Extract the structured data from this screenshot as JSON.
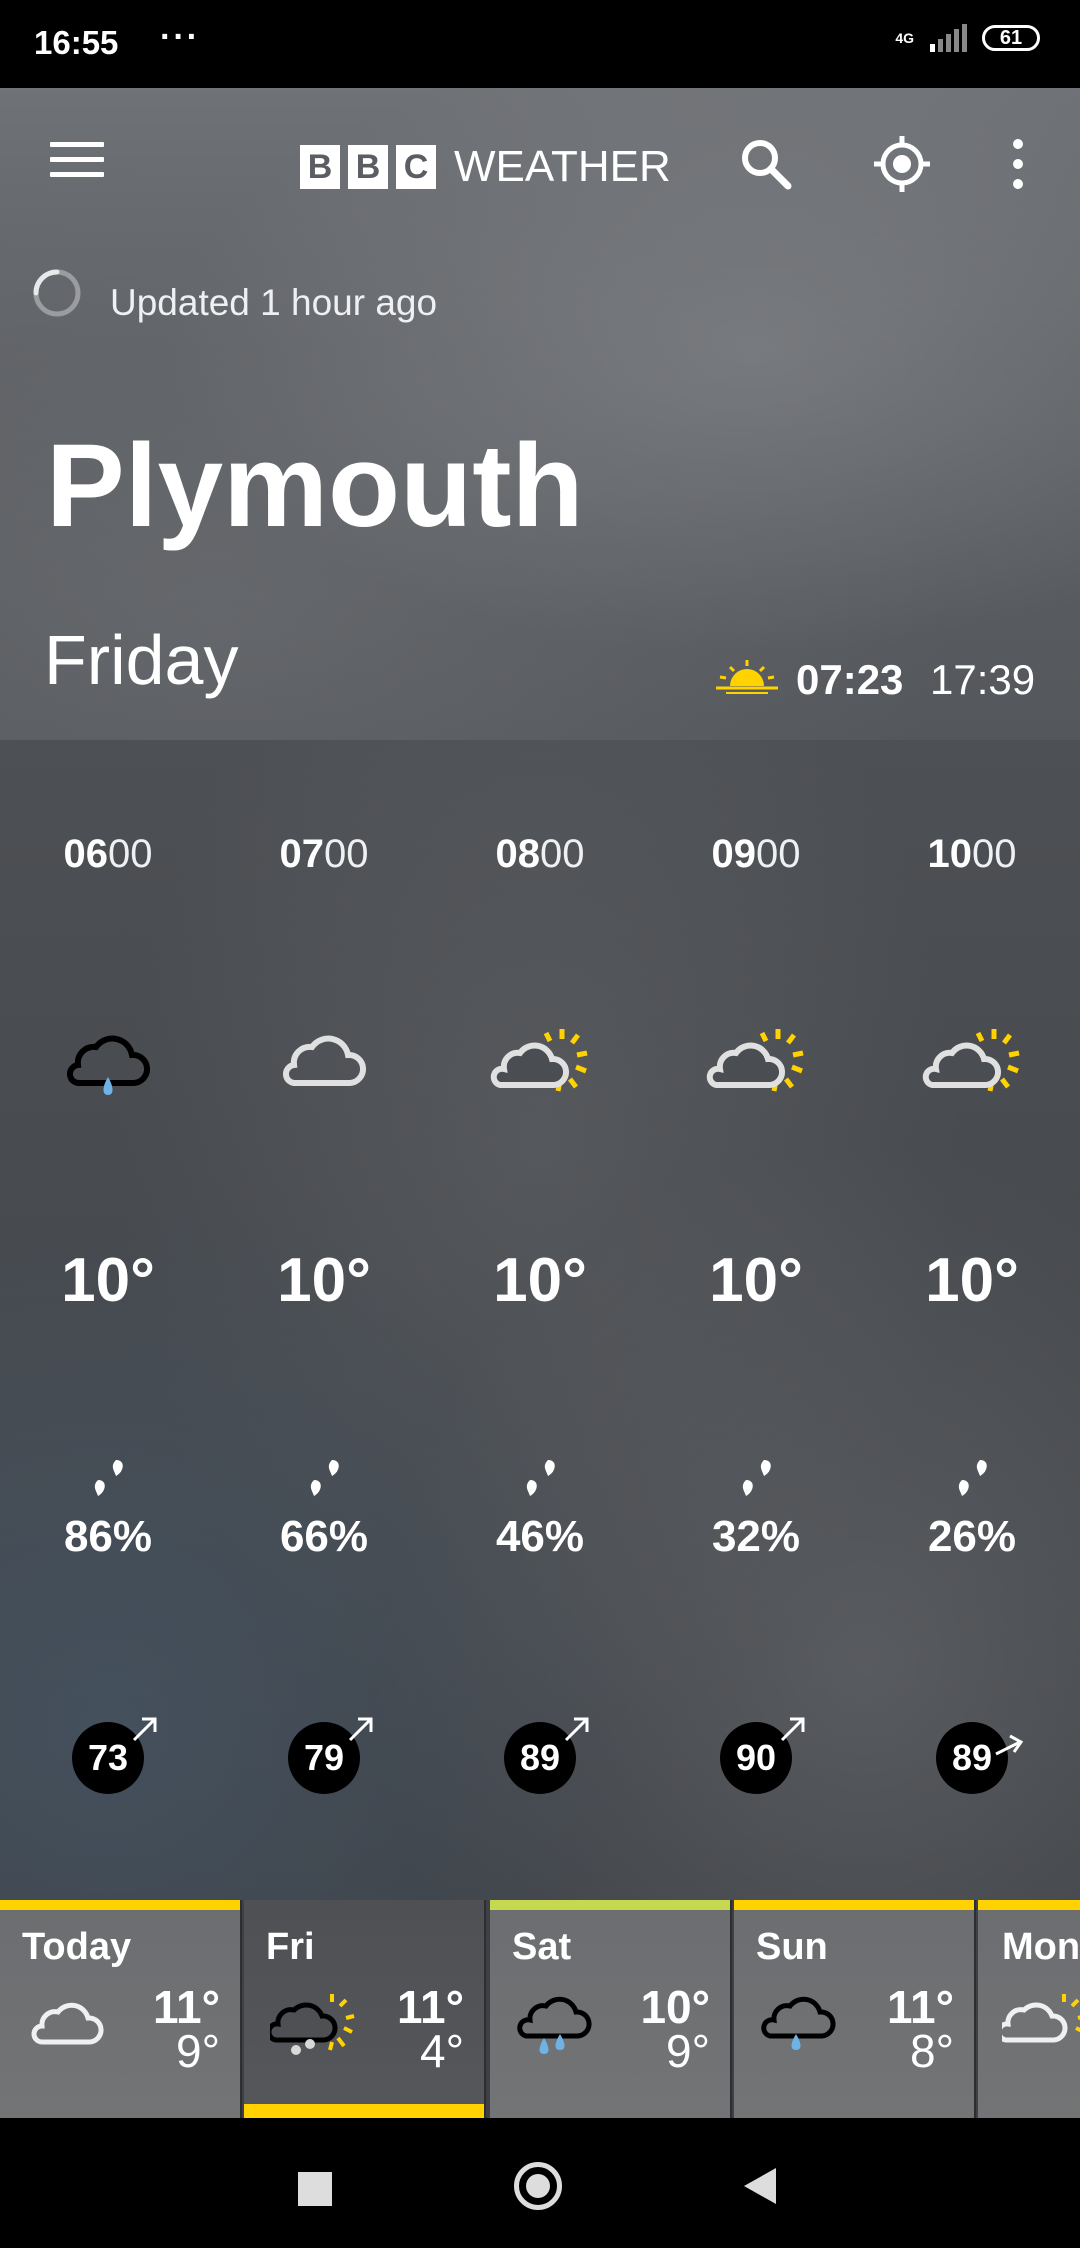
{
  "status_bar": {
    "time": "16:55",
    "dots": "···",
    "network": "4G",
    "battery": "61"
  },
  "header": {
    "brand_letters": [
      "B",
      "B",
      "C"
    ],
    "brand_word": "WEATHER",
    "updated": "Updated 1 hour ago",
    "city": "Plymouth",
    "day": "Friday",
    "sunrise": "07:23",
    "sunset": "17:39"
  },
  "hourly": [
    {
      "time_bold": "06",
      "time_rest": "00",
      "icon": "cloud-light-rain-icon",
      "temp": "10°",
      "rain": "86%",
      "wind": "73"
    },
    {
      "time_bold": "07",
      "time_rest": "00",
      "icon": "cloud-icon",
      "temp": "10°",
      "rain": "66%",
      "wind": "79"
    },
    {
      "time_bold": "08",
      "time_rest": "00",
      "icon": "sun-cloud-icon",
      "temp": "10°",
      "rain": "46%",
      "wind": "89"
    },
    {
      "time_bold": "09",
      "time_rest": "00",
      "icon": "sun-cloud-icon",
      "temp": "10°",
      "rain": "32%",
      "wind": "90"
    },
    {
      "time_bold": "10",
      "time_rest": "00",
      "icon": "sun-cloud-icon",
      "temp": "10°",
      "rain": "26%",
      "wind": "89"
    }
  ],
  "daily": [
    {
      "name": "Today",
      "icon": "cloud-icon",
      "high": "11°",
      "low": "9°"
    },
    {
      "name": "Fri",
      "icon": "sleet-sun-icon",
      "high": "11°",
      "low": "4°"
    },
    {
      "name": "Sat",
      "icon": "rain-cloud-icon",
      "high": "10°",
      "low": "9°"
    },
    {
      "name": "Sun",
      "icon": "light-rain-cloud-icon",
      "high": "11°",
      "low": "8°"
    },
    {
      "name": "Mon",
      "icon": "sun-cloud-icon",
      "high": "",
      "low": ""
    }
  ],
  "colors": {
    "accent_yellow": "#ffd200",
    "accent_green": "#c5d84f",
    "rain_blue": "#6fb3e6"
  }
}
